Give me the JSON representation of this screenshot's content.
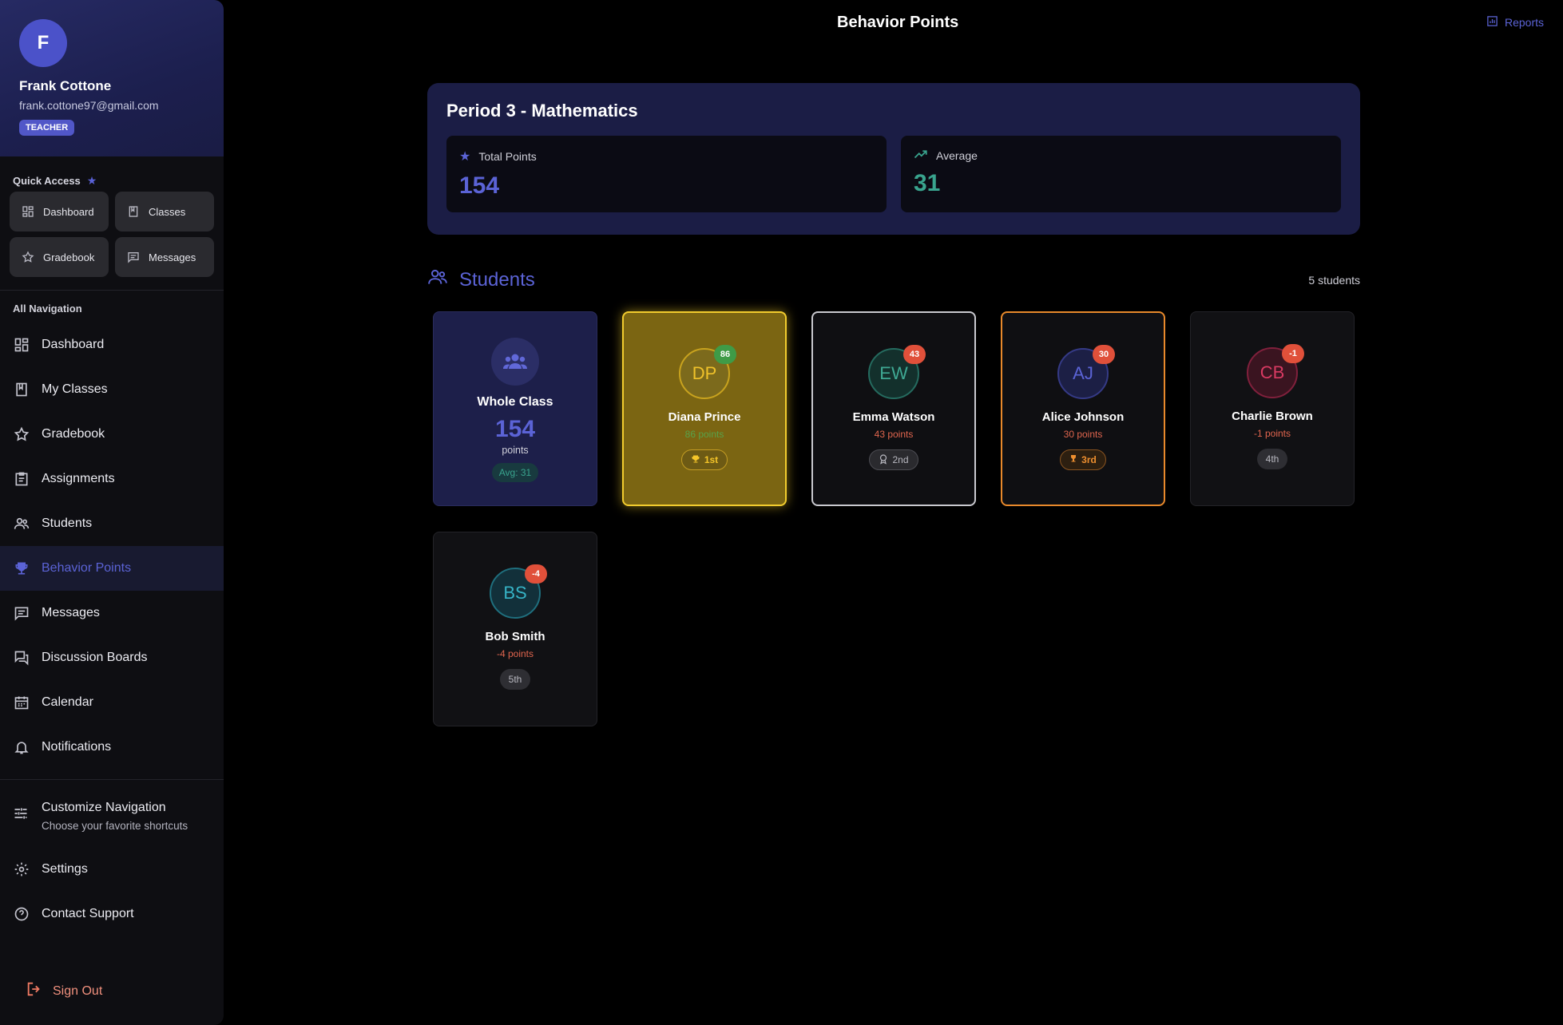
{
  "profile": {
    "initial": "F",
    "name": "Frank Cottone",
    "email": "frank.cottone97@gmail.com",
    "role": "TEACHER"
  },
  "quick_access": {
    "title": "Quick Access",
    "items": [
      {
        "label": "Dashboard",
        "icon": "dashboard-icon"
      },
      {
        "label": "Classes",
        "icon": "book-icon"
      },
      {
        "label": "Gradebook",
        "icon": "star-icon"
      },
      {
        "label": "Messages",
        "icon": "message-icon"
      }
    ]
  },
  "nav": {
    "title": "All Navigation",
    "items": [
      {
        "label": "Dashboard",
        "icon": "dashboard-icon"
      },
      {
        "label": "My Classes",
        "icon": "book-icon"
      },
      {
        "label": "Gradebook",
        "icon": "star-icon"
      },
      {
        "label": "Assignments",
        "icon": "assignment-icon"
      },
      {
        "label": "Students",
        "icon": "people-icon"
      },
      {
        "label": "Behavior Points",
        "icon": "trophy-icon",
        "active": true
      },
      {
        "label": "Messages",
        "icon": "message-icon"
      },
      {
        "label": "Discussion Boards",
        "icon": "forum-icon"
      },
      {
        "label": "Calendar",
        "icon": "calendar-icon"
      },
      {
        "label": "Notifications",
        "icon": "bell-icon"
      }
    ],
    "customize_title": "Customize Navigation",
    "customize_sub": "Choose your favorite shortcuts",
    "settings": "Settings",
    "support": "Contact Support",
    "signout": "Sign Out"
  },
  "header": {
    "title": "Behavior Points",
    "reports": "Reports"
  },
  "period": {
    "title": "Period 3 - Mathematics",
    "total_label": "Total Points",
    "total_value": "154",
    "avg_label": "Average",
    "avg_value": "31"
  },
  "students": {
    "title": "Students",
    "count": "5 students",
    "whole_class": {
      "title": "Whole Class",
      "total": "154",
      "unit": "points",
      "avg": "Avg: 31"
    },
    "list": [
      {
        "initials": "DP",
        "name": "Diana Prince",
        "badge": "86",
        "points": "86 points",
        "rank": "1st"
      },
      {
        "initials": "EW",
        "name": "Emma Watson",
        "badge": "43",
        "points": "43 points",
        "rank": "2nd"
      },
      {
        "initials": "AJ",
        "name": "Alice Johnson",
        "badge": "30",
        "points": "30 points",
        "rank": "3rd"
      },
      {
        "initials": "CB",
        "name": "Charlie Brown",
        "badge": "-1",
        "points": "-1 points",
        "rank": "4th"
      },
      {
        "initials": "BS",
        "name": "Bob Smith",
        "badge": "-4",
        "points": "-4 points",
        "rank": "5th"
      }
    ]
  },
  "colors": {
    "accent": "#5b63d6",
    "gold": "#e8b923",
    "bronze": "#e8892b",
    "teal": "#39a48e",
    "negative": "#e8543f"
  }
}
